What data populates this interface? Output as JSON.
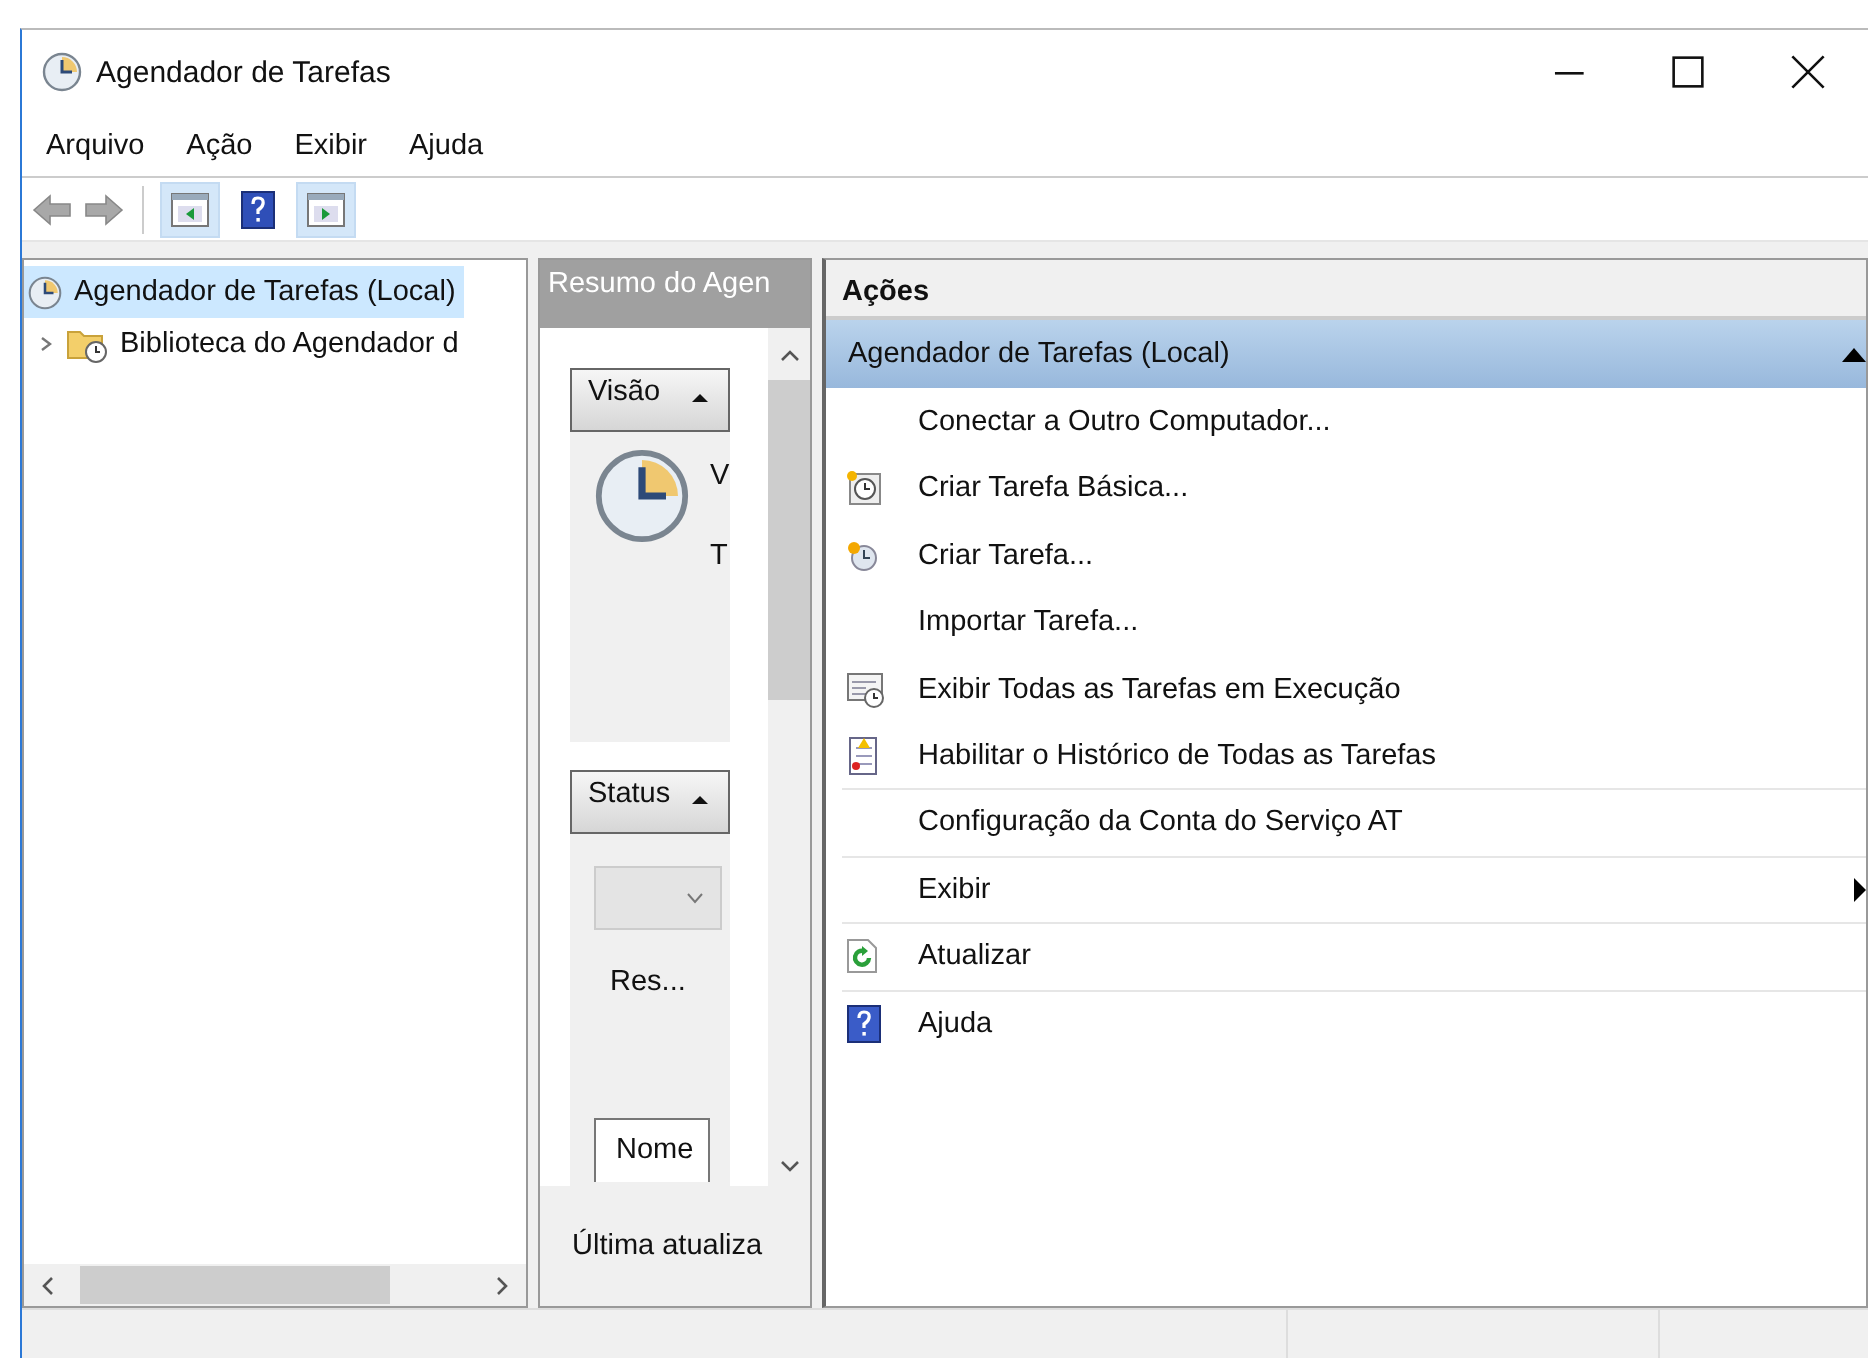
{
  "window": {
    "title": "Agendador de Tarefas"
  },
  "menu": [
    {
      "label": "Arquivo"
    },
    {
      "label": "Ação"
    },
    {
      "label": "Exibir"
    },
    {
      "label": "Ajuda"
    }
  ],
  "toolbar": [
    {
      "kind": "back",
      "disabled": true
    },
    {
      "kind": "forward",
      "disabled": true
    },
    {
      "kind": "tree-pane",
      "checked": true
    },
    {
      "kind": "help",
      "checked": false
    },
    {
      "kind": "action-pane",
      "checked": true
    }
  ],
  "tree": [
    {
      "label": "Agendador de Tarefas (Local)",
      "selected": true,
      "children": [
        {
          "label": "Biblioteca do Agendador d",
          "selected": false,
          "expanded": false
        }
      ]
    }
  ],
  "summary": {
    "title": "Resumo do Agen",
    "sections": [
      {
        "title": "Visão",
        "expanded": true
      },
      {
        "title": "Status",
        "expanded": true
      }
    ],
    "overview_lines": [
      "V",
      "T"
    ],
    "status_value": "Res...",
    "column": "Nome",
    "footer": "Última atualiza"
  },
  "actions": {
    "title": "Ações",
    "groups": [
      {
        "label": "Agendador de Tarefas (Local)",
        "expanded": true,
        "selected": true,
        "items": [
          {
            "label": "Conectar a Outro Computador...",
            "divided": false,
            "submenu": false
          },
          {
            "label": "Criar Tarefa Básica...",
            "divided": false,
            "submenu": false
          },
          {
            "label": "Criar Tarefa...",
            "divided": false,
            "submenu": false
          },
          {
            "label": "Importar Tarefa...",
            "divided": false,
            "submenu": false
          },
          {
            "label": "Exibir Todas as Tarefas em Execução",
            "divided": false,
            "submenu": false
          },
          {
            "label": "Habilitar o Histórico de Todas as Tarefas",
            "divided": true,
            "submenu": false
          },
          {
            "label": "Configuração da Conta do Serviço AT",
            "divided": true,
            "submenu": false
          },
          {
            "label": "Exibir",
            "divided": true,
            "submenu": true
          },
          {
            "label": "Atualizar",
            "divided": true,
            "submenu": false
          },
          {
            "label": "Ajuda",
            "divided": false,
            "submenu": false
          }
        ]
      }
    ]
  }
}
